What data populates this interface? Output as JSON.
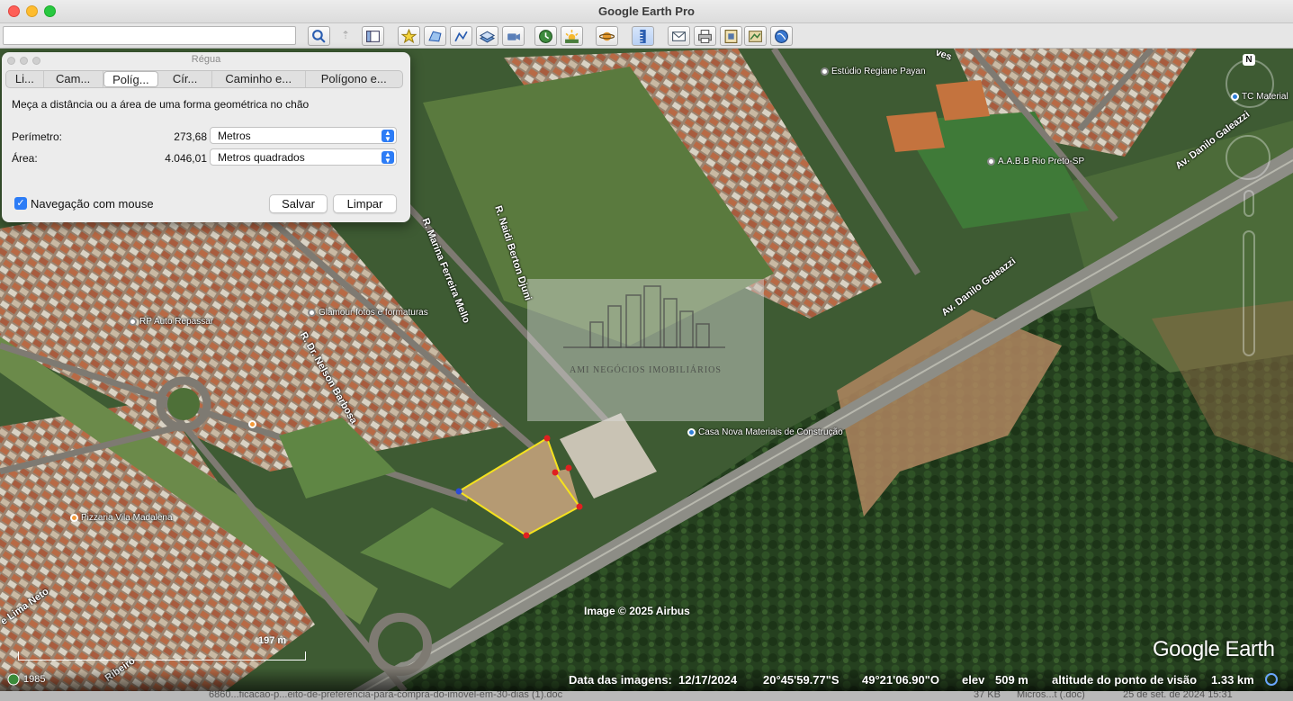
{
  "app": {
    "title": "Google Earth Pro"
  },
  "toolbar": {
    "search_value": "",
    "buttons": [
      "search-icon",
      "sidebar-icon",
      "placemark-icon",
      "polygon-icon",
      "path-icon",
      "overlay-icon",
      "record-tour-icon",
      "historical-imagery-icon",
      "sunlight-icon",
      "planets-icon",
      "ruler-icon",
      "email-icon",
      "print-icon",
      "save-image-icon",
      "map-icon",
      "earth-view-icon"
    ]
  },
  "ruler": {
    "title": "Régua",
    "tabs": [
      {
        "label": "Li..."
      },
      {
        "label": "Cam..."
      },
      {
        "label": "Políg..."
      },
      {
        "label": "Cír..."
      },
      {
        "label": "Caminho e..."
      },
      {
        "label": "Polígono e..."
      }
    ],
    "selected_tab": 2,
    "description": "Meça a distância ou a área de uma forma geométrica no chão",
    "perimeter": {
      "label": "Perímetro:",
      "value": "273,68",
      "unit": "Metros"
    },
    "area": {
      "label": "Área:",
      "value": "4.046,01",
      "unit": "Metros quadrados"
    },
    "mouse_nav": {
      "label": "Navegação com mouse",
      "checked": true
    },
    "save_label": "Salvar",
    "clear_label": "Limpar"
  },
  "map": {
    "places": {
      "studio": "Estúdio Regiane Payan",
      "aabb": "A.A.B.B Rio Preto-SP",
      "tc": "TC Material",
      "rp_auto": "RP Auto Repassar",
      "glamour": "Glamour fotos e formaturas",
      "casa_nova": "Casa Nova Materiais de Construção",
      "pizzaria": "Pizzaria Vila Madalena"
    },
    "streets": {
      "danilo1": "Av. Danilo Galeazzi",
      "danilo2": "Av. Danilo Galeazzi",
      "marina": "R. Marina Ferreira Mello",
      "naidi": "R. Naidi Berton Djuni",
      "nelson": "R. Dr. Nelson Barbosa",
      "lima": "e Lima Neto",
      "ribeiro": "Ribeiro",
      "ves": "ves"
    },
    "watermark": "AMI NEGÓCIOS IMOBILIÁRIOS",
    "copyright": "Image © 2025 Airbus",
    "logo": "Google Earth",
    "scale": "197 m",
    "compass": "N"
  },
  "status": {
    "history_year": "1985",
    "imagery_date_label": "Data das imagens:",
    "imagery_date": "12/17/2024",
    "lat": "20°45'59.77\"S",
    "lon": "49°21'06.90\"O",
    "elev_label": "elev",
    "elev": "509 m",
    "eye_alt_label": "altitude do ponto de visão",
    "eye_alt": "1.33 km"
  },
  "taskbar": {
    "file": "6860...ficacao-p...eito-de-preferencia-para-compra-do-imovel-em-30-dias (1).doc",
    "size": "37 KB",
    "kind": "Micros...t (.doc)",
    "date": "25 de set. de 2024 15:31"
  }
}
